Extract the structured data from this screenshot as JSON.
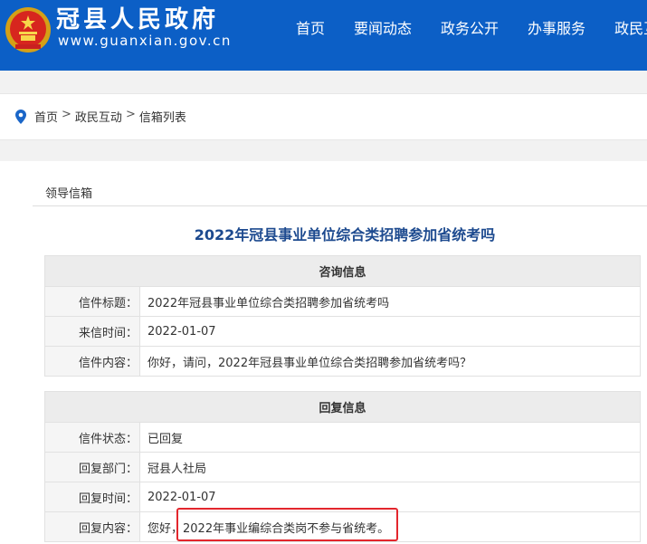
{
  "header": {
    "site_title": "冠县人民政府",
    "site_url": "www.guanxian.gov.cn",
    "nav": [
      "首页",
      "要闻动态",
      "政务公开",
      "办事服务",
      "政民互动"
    ]
  },
  "breadcrumb": [
    "首页",
    "政民互动",
    "信箱列表"
  ],
  "main": {
    "section_tab": "领导信箱",
    "title": "2022年冠县事业单位综合类招聘参加省统考吗",
    "consult": {
      "header": "咨询信息",
      "rows": [
        {
          "label": "信件标题：",
          "value": "2022年冠县事业单位综合类招聘参加省统考吗"
        },
        {
          "label": "来信时间：",
          "value": "2022-01-07"
        },
        {
          "label": "信件内容：",
          "value": "你好，请问，2022年冠县事业单位综合类招聘参加省统考吗？"
        }
      ]
    },
    "reply": {
      "header": "回复信息",
      "rows": [
        {
          "label": "信件状态：",
          "value": "已回复"
        },
        {
          "label": "回复部门：",
          "value": "冠县人社局"
        },
        {
          "label": "回复时间：",
          "value": "2022-01-07"
        },
        {
          "label": "回复内容：",
          "value": "您好，2022年事业编综合类岗不参与省统考。"
        }
      ]
    }
  },
  "colors": {
    "header_bg": "#0c5fc6",
    "title": "#1d4a8f",
    "highlight": "#e3262d"
  }
}
